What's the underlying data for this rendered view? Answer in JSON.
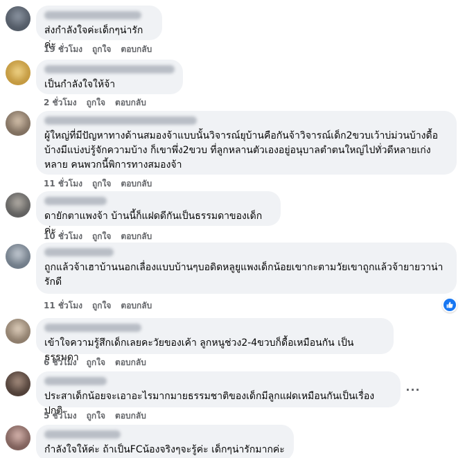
{
  "comments": [
    {
      "text": "ส่งกำลังใจค่ะเด็กๆน่ารักค่ะ",
      "time": "19 ชั่วโมง",
      "like": "ถูกใจ",
      "reply": "ตอบกลับ"
    },
    {
      "text": "เป็นกำลังใจให้จ้า",
      "time": "2 ชั่วโมง",
      "like": "ถูกใจ",
      "reply": "ตอบกลับ"
    },
    {
      "text": "ผู้ใหญ่ที่มีปัญหาทางด้านสมองจ้าแบบนั้นวิจารณ์ยุบ้านคือกันจ้าวิจารณ์เด็ก2ขวบเว้าบ่ม่วนบ้างดื้อบ้างมีแบ่งบ่รู้จักความบ้าง ก็เขาพึ่ง2ขวบ ที่ลูกหลานตัวเองอยู่อนุบาลตำตนใหญ่ไปทั่วดีหลายเก่งหลาย คนพวกนี้พิการทางสมองจ้า",
      "time": "11 ชั่วโมง",
      "like": "ถูกใจ",
      "reply": "ตอบกลับ"
    },
    {
      "text": "ดายักตาแพงจ้า บ้านนี้ก็แฝดดีกันเป็นธรรมดาของเด็กค่ะ",
      "time": "10 ชั่วโมง",
      "like": "ถูกใจ",
      "reply": "ตอบกลับ"
    },
    {
      "text": "ถูกแล้วจ้าเฮาบ้านนอกเลื่องแบบบ้านๆบอดิดหลูยูแพงเด็กน้อยเขากะตามวัยเขาถูกแล้วจ้ายายวาน่ารักดี",
      "time": "11 ชั่วโมง",
      "like": "ถูกใจ",
      "reply": "ตอบกลับ"
    },
    {
      "text": "เข้าใจความรู้สึกเด็กเลยคะวัยของเค้า ลูกหนูช่วง2-4ขวบก็ดื้อเหมือนกัน เป็นธรรมดา",
      "time": "6 ชั่วโมง",
      "like": "ถูกใจ",
      "reply": "ตอบกลับ"
    },
    {
      "text": "ประสาเด็กน้อยจะเอาอะไรมากมายธรรมชาติของเด็กมีลูกแฝดเหมือนกันเป็นเรื่องปกติ",
      "time": "5 ชั่วโมง",
      "like": "ถูกใจ",
      "reply": "ตอบกลับ"
    },
    {
      "text": "กำลังใจให้ค่ะ ถ้าเป็นFCน้องจริงๆจะรู้ค่ะ เด็กๆน่ารักมากค่ะ",
      "time": "",
      "like": "",
      "reply": ""
    }
  ],
  "more_label": "···",
  "colors": {
    "bubble": "#f0f2f5",
    "meta": "#65676b",
    "like_blue": "#1877f2",
    "heart_pink": "#f06bb4"
  },
  "icons": {
    "like_badge": "thumbs-up-icon",
    "more": "more-options-icon",
    "heart": "pink-heart-icon"
  }
}
